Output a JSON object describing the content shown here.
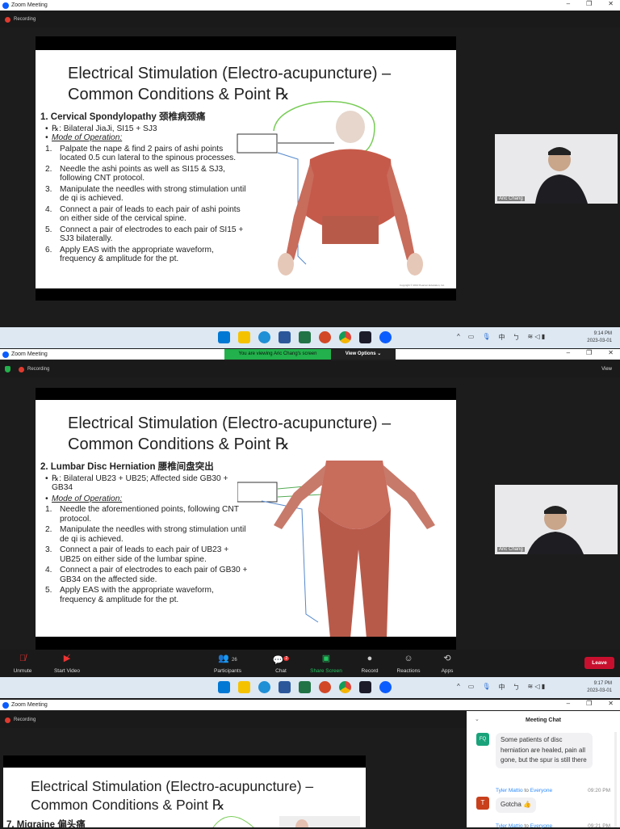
{
  "window": {
    "title": "Zoom Meeting",
    "recording": "Recording",
    "minimize": "–",
    "restore": "❐",
    "close": "✕"
  },
  "slide": {
    "title_line1": "Electrical Stimulation (Electro-acupuncture) –",
    "title_line2": "Common Conditions & Point ℞"
  },
  "slide1": {
    "heading": "1.   Cervical Spondylopathy 颈椎病颈痛",
    "rx": "℞: Bilateral JiaJi, SI15 + SJ3",
    "mode": "Mode of Operation:",
    "steps": [
      "Palpate the nape & find 2 pairs of ashi points located 0.5 cun lateral to the spinous processes.",
      "Needle the ashi points as well as SI15 & SJ3, following CNT protocol.",
      "Manipulate the needles with strong stimulation until de qi is achieved.",
      "Connect a pair of leads to each pair of ashi points on either side of the cervical spine.",
      "Connect a pair of electrodes to each pair of SI15 + SJ3 bilaterally.",
      "Apply EAS with the appropriate waveform, frequency & amplitude for the pt."
    ],
    "copyright": "Copyright © 2010 Pearson Education, Inc."
  },
  "slide2": {
    "heading": "2.   Lumbar Disc Herniation 腰椎间盘突出",
    "rx": "℞: Bilateral UB23 + UB25; Affected side GB30 + GB34",
    "mode": "Mode of Operation:",
    "steps": [
      "Needle the aforementioned points, following CNT protocol.",
      "Manipulate the needles with strong stimulation until de qi is achieved.",
      "Connect a pair of leads to each pair of UB23 + UB25 on either side of the lumbar spine.",
      "Connect a pair of electrodes to each pair of GB30 + GB34 on the affected side.",
      "Apply EAS with the appropriate waveform, frequency & amplitude for the pt."
    ]
  },
  "slide3": {
    "heading": "7.   Migraine 偏头痛"
  },
  "video": {
    "name": "Aric Chang"
  },
  "taskbar1": {
    "time": "9:14 PM",
    "date": "2023-03-01"
  },
  "taskbar2": {
    "time": "9:17 PM",
    "date": "2023-03-01"
  },
  "tray": {
    "ime": "中",
    "ime2": "ㄅ"
  },
  "banner": {
    "viewing": "You are viewing Aric Chang's screen",
    "view_options": "View Options ⌄",
    "view": "View"
  },
  "toolbar": {
    "unmute": "Unmute",
    "start_video": "Start Video",
    "participants": "Participants",
    "participants_count": "26",
    "chat": "Chat",
    "chat_badge": "2",
    "share": "Share Screen",
    "record": "Record",
    "reactions": "Reactions",
    "apps": "Apps",
    "leave": "Leave"
  },
  "chat": {
    "title": "Meeting Chat",
    "messages": [
      {
        "initials": "FQ",
        "text": "Some patients  of disc herniation are healed, pain all gone, but the spur is still there"
      },
      {
        "sender": "Tyler Mattio",
        "to": "to",
        "recipient": "Everyone",
        "time": "09:20 PM",
        "initials": "T",
        "text": "Gotcha 👍"
      },
      {
        "sender": "Tyler Mattio",
        "to": "to",
        "recipient": "Everyone",
        "time": "09:21 PM"
      }
    ]
  },
  "colors": {
    "zoom_blue": "#0b5cff",
    "leave_red": "#c8102e",
    "banner_green": "#22b14c",
    "share_green": "#22c55e"
  }
}
